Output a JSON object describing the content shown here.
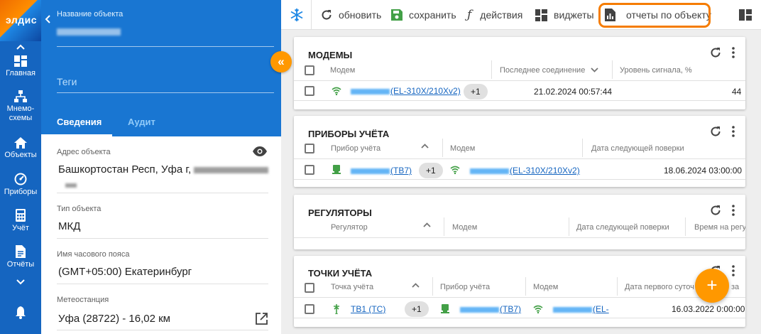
{
  "rail": {
    "logo_text": "элдис",
    "items": [
      {
        "label": "Главная",
        "icon": "dashboard-icon"
      },
      {
        "label": "Мнемо-\nсхемы",
        "icon": "hierarchy-icon"
      },
      {
        "label": "Объекты",
        "icon": "home-icon"
      },
      {
        "label": "Приборы",
        "icon": "gauge-icon"
      },
      {
        "label": "Учёт",
        "icon": "calculator-icon"
      },
      {
        "label": "Отчёты",
        "icon": "document-icon"
      }
    ]
  },
  "object_panel": {
    "name_label": "Название объекта",
    "tags_placeholder": "Теги",
    "tabs": [
      "Сведения",
      "Аудит"
    ],
    "fields": [
      {
        "label": "Адрес объекта",
        "value": "Башкортостан Респ, Уфа г,"
      },
      {
        "label": "Тип объекта",
        "value": "МКД"
      },
      {
        "label": "Имя часового пояса",
        "value": "(GMT+05:00) Екатеринбург"
      },
      {
        "label": "Метеостанция",
        "value": "Уфа (28722) - 16,02 км"
      }
    ]
  },
  "toolbar": {
    "refresh_label": "обновить",
    "save_label": "сохранить",
    "actions_label": "действия",
    "widgets_label": "виджеты",
    "reports_label": "отчеты по объекту"
  },
  "cards": {
    "modems": {
      "title": "МОДЕМЫ",
      "columns": [
        "Модем",
        "Последнее соединение",
        "Уровень сигнала, %"
      ],
      "row": {
        "modem_suffix": "(EL-310X/210Xv2)",
        "chip": "+1",
        "last_connection": "21.02.2024 00:57:44",
        "signal": "44"
      }
    },
    "meters": {
      "title": "ПРИБОРЫ УЧЁТА",
      "columns": [
        "Прибор учёта",
        "Модем",
        "Дата следующей поверки"
      ],
      "row": {
        "meter_suffix": "(ТВ7)",
        "chip": "+1",
        "modem_suffix": "(EL-310X/210Xv2)",
        "next_check": "18.06.2024 03:00:00"
      }
    },
    "regulators": {
      "title": "РЕГУЛЯТОРЫ",
      "columns": [
        "Регулятор",
        "Модем",
        "Дата следующей поверки",
        "Время на регу"
      ]
    },
    "points": {
      "title": "ТОЧКИ УЧЁТА",
      "columns": [
        "Точка учёта",
        "Прибор учёта",
        "Модем",
        "Дата первого суточ",
        "за"
      ],
      "row": {
        "point": "ТВ1 (ТС)",
        "chip": "+1",
        "meter_suffix": "(ТВ7)",
        "modem_suffix": "(EL-",
        "first_date": "16.03.2022 0:00:00"
      }
    }
  },
  "colors": {
    "rail": "#1565c0",
    "header": "#1976d2",
    "accent": "#ff9800",
    "link": "#1565c0",
    "signal_green": "#43a047"
  }
}
